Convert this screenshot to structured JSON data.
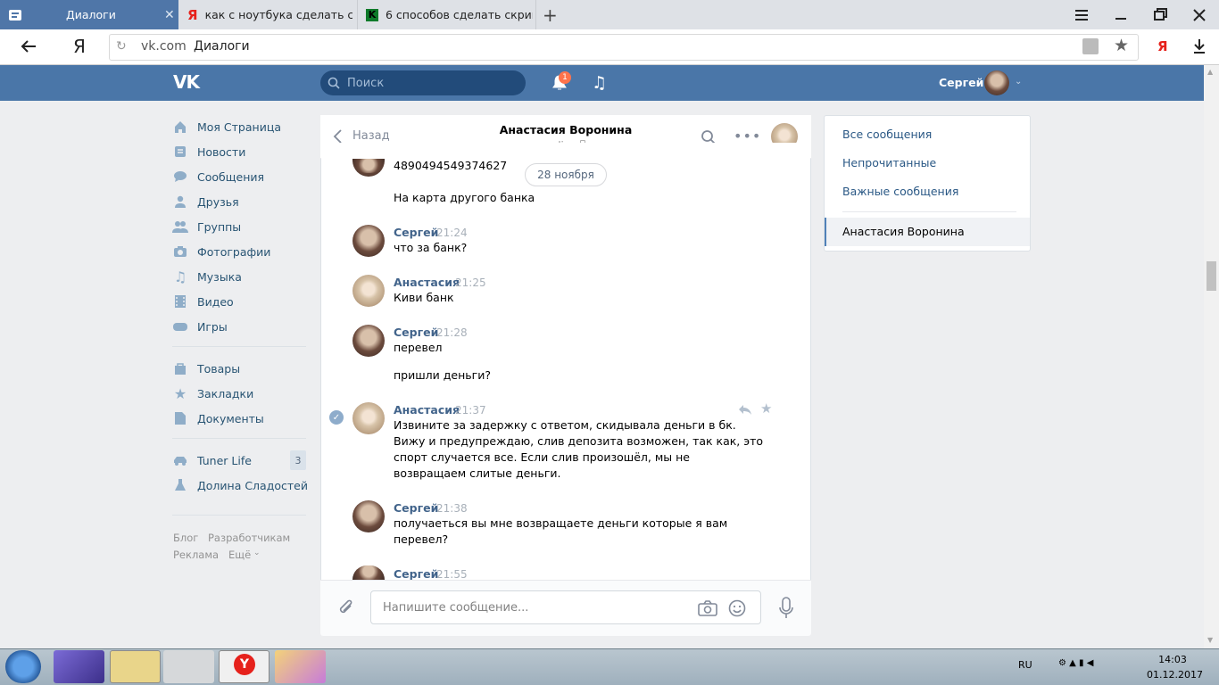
{
  "browser": {
    "tabs": [
      {
        "title": "Диалоги",
        "active": true
      },
      {
        "title": "как с ноутбука сделать скри",
        "active": false
      },
      {
        "title": "6 способов сделать скрин",
        "active": false
      }
    ],
    "address": {
      "domain": "vk.com",
      "page": "Диалоги"
    }
  },
  "vk": {
    "search_placeholder": "Поиск",
    "notif_count": "1",
    "user_name": "Сергей"
  },
  "nav": {
    "items": [
      {
        "label": "Моя Страница",
        "icon": "home-icon"
      },
      {
        "label": "Новости",
        "icon": "news-icon"
      },
      {
        "label": "Сообщения",
        "icon": "messages-icon"
      },
      {
        "label": "Друзья",
        "icon": "friends-icon"
      },
      {
        "label": "Группы",
        "icon": "groups-icon"
      },
      {
        "label": "Фотографии",
        "icon": "camera-icon"
      },
      {
        "label": "Музыка",
        "icon": "music-icon"
      },
      {
        "label": "Видео",
        "icon": "video-icon"
      },
      {
        "label": "Игры",
        "icon": "gamepad-icon"
      }
    ],
    "items2": [
      {
        "label": "Товары",
        "icon": "bag-icon"
      },
      {
        "label": "Закладки",
        "icon": "star-icon"
      },
      {
        "label": "Документы",
        "icon": "document-icon"
      }
    ],
    "apps": [
      {
        "label": "Tuner Life",
        "badge": "3"
      },
      {
        "label": "Долина Сладостей",
        "badge": ""
      }
    ],
    "footer": {
      "blog": "Блог",
      "dev": "Разработчикам",
      "ads": "Реклама",
      "more": "Ещё"
    }
  },
  "chat": {
    "back": "Назад",
    "name": "Анастасия Воронина",
    "status": "online",
    "date_pill": "28 ноября",
    "first_line": "4890494549374627",
    "first_line2": "На карта другого банка",
    "messages": [
      {
        "author": "Сергей",
        "time": "21:24",
        "lines": [
          "что за банк?"
        ]
      },
      {
        "author": "Анастасия",
        "time": "21:25",
        "lines": [
          "Киви банк"
        ]
      },
      {
        "author": "Сергей",
        "time": "21:28",
        "lines": [
          "перевел",
          "пришли деньги?"
        ]
      },
      {
        "author": "Анастасия",
        "time": "21:37",
        "lines": [
          "Извините за задержку с ответом, скидывала деньги в бк.",
          "Вижу и предупреждаю, слив депозита возможен, так как, это",
          "спорт случается все. Если слив произошёл, мы не",
          "возвращаем слитые деньги."
        ]
      },
      {
        "author": "Сергей",
        "time": "21:38",
        "lines": [
          "получаеться вы мне возвращаете деньги которые я вам",
          "перевел?"
        ]
      },
      {
        "author": "Сергей",
        "time": "21:55",
        "lines": []
      }
    ],
    "input_placeholder": "Напишите сообщение..."
  },
  "right": {
    "all": "Все сообщения",
    "unread": "Непрочитанные",
    "important": "Важные сообщения",
    "dialog": "Анастасия Воронина"
  },
  "taskbar": {
    "lang": "RU",
    "time": "14:03",
    "date": "01.12.2017"
  }
}
